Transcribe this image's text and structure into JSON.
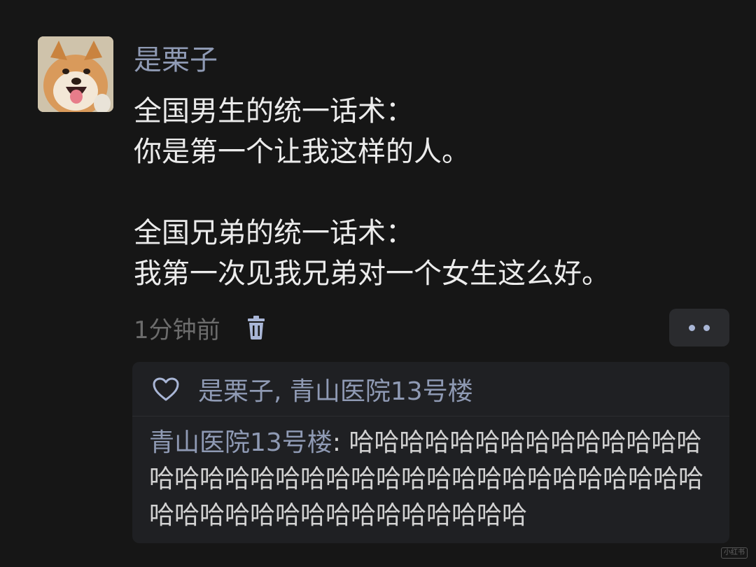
{
  "post": {
    "username": "是栗子",
    "content_lines": [
      "全国男生的统一话术：",
      "你是第一个让我这样的人。",
      "",
      "全国兄弟的统一话术：",
      "我第一次见我兄弟对一个女生这么好。"
    ],
    "timestamp": "1分钟前",
    "delete_icon": "trash-icon",
    "more_icon": "more-dots-icon"
  },
  "reactions": {
    "like_icon": "heart-icon",
    "likers": "是栗子, 青山医院13号楼"
  },
  "comment": {
    "author": "青山医院13号楼",
    "separator": ": ",
    "text": "哈哈哈哈哈哈哈哈哈哈哈哈哈哈哈哈哈哈哈哈哈哈哈哈哈哈哈哈哈哈哈哈哈哈哈哈哈哈哈哈哈哈哈哈哈哈哈哈哈哈哈"
  },
  "watermark": "小红书",
  "colors": {
    "background": "#161616",
    "accent": "#8f9ab4",
    "text": "#ececec",
    "muted": "#6c6c6c",
    "panel": "#1f2023"
  }
}
